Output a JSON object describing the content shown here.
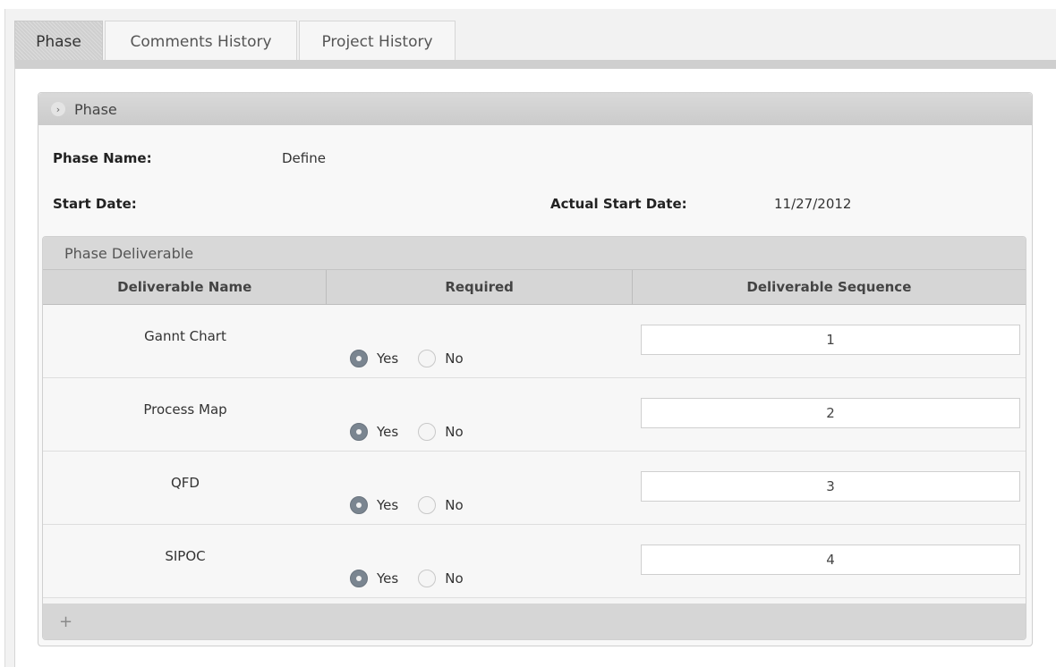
{
  "tabs": [
    {
      "label": "Phase",
      "active": true
    },
    {
      "label": "Comments History",
      "active": false
    },
    {
      "label": "Project History",
      "active": false
    }
  ],
  "phase_panel": {
    "title": "Phase",
    "fields": {
      "phase_name_label": "Phase Name:",
      "phase_name_value": "Define",
      "start_date_label": "Start Date:",
      "start_date_value": "",
      "actual_start_date_label": "Actual Start Date:",
      "actual_start_date_value": "11/27/2012"
    }
  },
  "deliverables": {
    "title": "Phase Deliverable",
    "columns": [
      "Deliverable Name",
      "Required",
      "Deliverable Sequence"
    ],
    "radio_labels": {
      "yes": "Yes",
      "no": "No"
    },
    "rows": [
      {
        "name": "Gannt Chart",
        "required": "Yes",
        "sequence": "1"
      },
      {
        "name": "Process Map",
        "required": "Yes",
        "sequence": "2"
      },
      {
        "name": "QFD",
        "required": "Yes",
        "sequence": "3"
      },
      {
        "name": "SIPOC",
        "required": "Yes",
        "sequence": "4"
      }
    ],
    "add_icon": "+"
  },
  "colors": {
    "header_bg": "#d6d6d6",
    "radio_selected": "#7a8590"
  }
}
